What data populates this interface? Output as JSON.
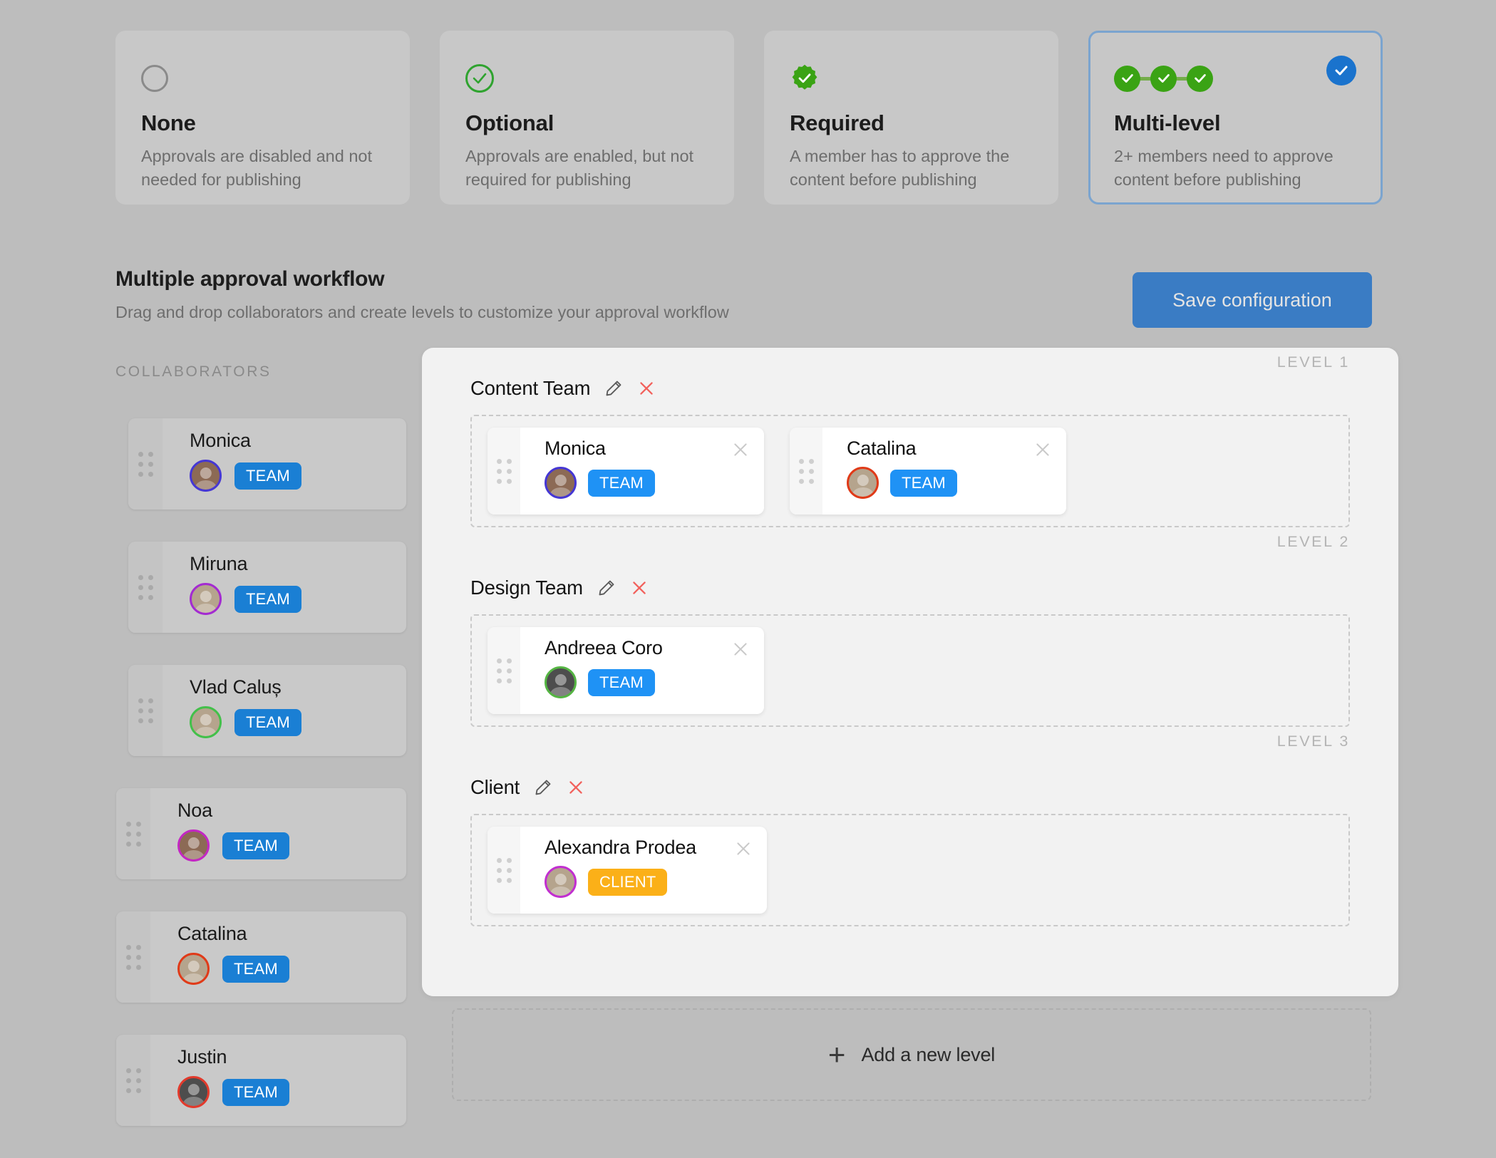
{
  "modes": [
    {
      "id": "none",
      "icon": "empty-circle-icon",
      "title": "None",
      "description": "Approvals are disabled and not needed for publishing",
      "selected": false
    },
    {
      "id": "optional",
      "icon": "check-circle-outline-icon",
      "title": "Optional",
      "description": "Approvals are enabled, but not required for publishing",
      "selected": false
    },
    {
      "id": "required",
      "icon": "verified-badge-icon",
      "title": "Required",
      "description": "A member has to approve the content before publishing",
      "selected": false
    },
    {
      "id": "multi-level",
      "icon": "multi-level-chain-icon",
      "title": "Multi-level",
      "description": "2+ members need to approve content before publishing",
      "selected": true
    }
  ],
  "section": {
    "title": "Multiple approval workflow",
    "subtitle": "Drag and drop collaborators and create levels to customize your approval workflow",
    "save_label": "Save configuration",
    "collaborators_label": "COLLABORATORS"
  },
  "collaborators": [
    {
      "name": "Monica",
      "role": "TEAM",
      "ring": "#4537d4",
      "tone": "warm"
    },
    {
      "name": "Miruna",
      "role": "TEAM",
      "ring": "#a32bd1",
      "tone": "light"
    },
    {
      "name": "Vlad Caluș",
      "role": "TEAM",
      "ring": "#43c04a",
      "tone": "light"
    },
    {
      "name": "Noa",
      "role": "TEAM",
      "ring": "#c327c3",
      "tone": "warm"
    },
    {
      "name": "Catalina",
      "role": "TEAM",
      "ring": "#e03a18",
      "tone": "light"
    },
    {
      "name": "Justin",
      "role": "TEAM",
      "ring": "#e23a2c",
      "tone": "dark"
    }
  ],
  "levels": [
    {
      "name": "Content Team",
      "tag": "LEVEL 1",
      "members": [
        {
          "name": "Monica",
          "role": "TEAM",
          "ring": "#4537d4",
          "tone": "warm"
        },
        {
          "name": "Catalina",
          "role": "TEAM",
          "ring": "#e03a18",
          "tone": "light"
        }
      ]
    },
    {
      "name": "Design Team",
      "tag": "LEVEL 2",
      "members": [
        {
          "name": "Andreea Coro",
          "role": "TEAM",
          "ring": "#55b543",
          "tone": "dark"
        }
      ]
    },
    {
      "name": "Client",
      "tag": "LEVEL 3",
      "members": [
        {
          "name": "Alexandra Prodea",
          "role": "CLIENT",
          "ring": "#c12fd0",
          "tone": "light"
        }
      ]
    }
  ],
  "add_level": {
    "label": "Add a new level",
    "icon": "plus-icon"
  },
  "colors": {
    "accent_blue": "#1a73cd",
    "save_blue": "#3a7cc4",
    "team_badge": "#1a7fd4",
    "client_badge": "#fbb018",
    "green": "#3aa314",
    "red_x": "#f2615c",
    "selected_border": "#7ba4cf"
  }
}
